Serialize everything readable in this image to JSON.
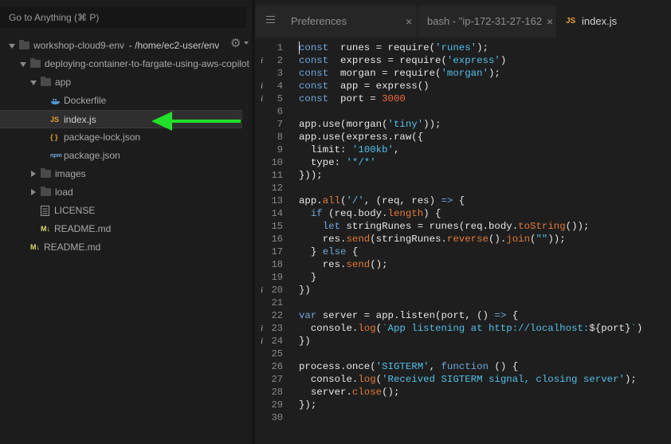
{
  "search": {
    "placeholder": "Go to Anything (⌘ P)"
  },
  "tree": [
    {
      "label": "workshop-cloud9-env",
      "suffix": " - /home/ec2-user/env",
      "indent": 0,
      "type": "folder",
      "arrow": "down"
    },
    {
      "label": "deploying-container-to-fargate-using-aws-copilot",
      "indent": 1,
      "type": "folder",
      "arrow": "down"
    },
    {
      "label": "app",
      "indent": 2,
      "type": "folder",
      "arrow": "down"
    },
    {
      "label": "Dockerfile",
      "indent": 3,
      "type": "docker"
    },
    {
      "label": "index.js",
      "indent": 3,
      "type": "js",
      "selected": true
    },
    {
      "label": "package-lock.json",
      "indent": 3,
      "type": "json"
    },
    {
      "label": "package.json",
      "indent": 3,
      "type": "npm"
    },
    {
      "label": "images",
      "indent": 2,
      "type": "folder",
      "arrow": "right"
    },
    {
      "label": "load",
      "indent": 2,
      "type": "folder",
      "arrow": "right"
    },
    {
      "label": "LICENSE",
      "indent": 2,
      "type": "doc"
    },
    {
      "label": "README.md",
      "indent": 2,
      "type": "md"
    },
    {
      "label": "README.md",
      "indent": 1,
      "type": "md"
    }
  ],
  "tabs": [
    {
      "label": "Preferences",
      "close": "×"
    },
    {
      "label": "bash - \"ip-172-31-27-162",
      "close": "×"
    },
    {
      "label": "index.js",
      "badge": "JS",
      "active": true
    }
  ],
  "file_icons": {
    "js": "JS",
    "json": "{ }",
    "npm": "npm",
    "md": "M↓"
  },
  "colors": {
    "keyword": "#6fa8dc",
    "string": "#52c0e8",
    "number": "#ef6a36",
    "function": "#e47a3a",
    "arrow": "#22e02a",
    "js_badge": "#e0a030"
  },
  "info_lines": [
    2,
    4,
    5,
    20,
    23,
    24
  ],
  "code": [
    [
      [
        "kw",
        "const"
      ],
      [
        "",
        "  runes = require("
      ],
      [
        "str",
        "'runes'"
      ],
      [
        "",
        ");"
      ]
    ],
    [
      [
        "kw",
        "const"
      ],
      [
        "",
        "  express = require("
      ],
      [
        "str",
        "'express'"
      ],
      [
        "",
        ")"
      ]
    ],
    [
      [
        "kw",
        "const"
      ],
      [
        "",
        "  morgan = require("
      ],
      [
        "str",
        "'morgan'"
      ],
      [
        "",
        ");"
      ]
    ],
    [
      [
        "kw",
        "const"
      ],
      [
        "",
        "  app = express()"
      ]
    ],
    [
      [
        "kw",
        "const"
      ],
      [
        "",
        "  port = "
      ],
      [
        "num",
        "3000"
      ]
    ],
    [],
    [
      [
        "",
        "app.use(morgan("
      ],
      [
        "str",
        "'tiny'"
      ],
      [
        "",
        "));"
      ]
    ],
    [
      [
        "",
        "app.use(express.raw({"
      ]
    ],
    [
      [
        "",
        "  limit: "
      ],
      [
        "str",
        "'100kb'"
      ],
      [
        "",
        ","
      ]
    ],
    [
      [
        "",
        "  type: "
      ],
      [
        "str",
        "'*/*'"
      ]
    ],
    [
      [
        "",
        "}));"
      ]
    ],
    [],
    [
      [
        "",
        "app."
      ],
      [
        "fn",
        "all"
      ],
      [
        "",
        "("
      ],
      [
        "str",
        "'/'"
      ],
      [
        "",
        ", (req, res) "
      ],
      [
        "kw",
        "=>"
      ],
      [
        "",
        " {"
      ]
    ],
    [
      [
        "",
        "  "
      ],
      [
        "kw",
        "if"
      ],
      [
        "",
        " (req.body."
      ],
      [
        "fn",
        "length"
      ],
      [
        "",
        ") {"
      ]
    ],
    [
      [
        "",
        "    "
      ],
      [
        "kw",
        "let"
      ],
      [
        "",
        " stringRunes = runes(req.body."
      ],
      [
        "fn",
        "toString"
      ],
      [
        "",
        "());"
      ]
    ],
    [
      [
        "",
        "    res."
      ],
      [
        "fn",
        "send"
      ],
      [
        "",
        "(stringRunes."
      ],
      [
        "fn",
        "reverse"
      ],
      [
        "",
        "()."
      ],
      [
        "fn",
        "join"
      ],
      [
        "",
        "("
      ],
      [
        "str",
        "\"\""
      ],
      [
        "",
        "));"
      ]
    ],
    [
      [
        "",
        "  } "
      ],
      [
        "kw",
        "else"
      ],
      [
        "",
        " {"
      ]
    ],
    [
      [
        "",
        "    res."
      ],
      [
        "fn",
        "send"
      ],
      [
        "",
        "();"
      ]
    ],
    [
      [
        "",
        "  }"
      ]
    ],
    [
      [
        "",
        "})"
      ]
    ],
    [],
    [
      [
        "kw",
        "var"
      ],
      [
        "",
        " server = app.listen(port, () "
      ],
      [
        "kw",
        "=>"
      ],
      [
        "",
        " {"
      ]
    ],
    [
      [
        "",
        "  console."
      ],
      [
        "fn",
        "log"
      ],
      [
        "",
        "("
      ],
      [
        "str",
        "`App listening at http://localhost:"
      ],
      [
        "",
        "${port}"
      ],
      [
        "str",
        "`"
      ],
      [
        "",
        ")"
      ]
    ],
    [
      [
        "",
        "})"
      ]
    ],
    [],
    [
      [
        "",
        "process.once("
      ],
      [
        "str",
        "'SIGTERM'"
      ],
      [
        "",
        ", "
      ],
      [
        "kw",
        "function"
      ],
      [
        "",
        " () {"
      ]
    ],
    [
      [
        "",
        "  console."
      ],
      [
        "fn",
        "log"
      ],
      [
        "",
        "("
      ],
      [
        "str",
        "'Received SIGTERM signal, closing server'"
      ],
      [
        "",
        ");"
      ]
    ],
    [
      [
        "",
        "  server."
      ],
      [
        "fn",
        "close"
      ],
      [
        "",
        "();"
      ]
    ],
    [
      [
        "",
        "});"
      ]
    ],
    []
  ]
}
